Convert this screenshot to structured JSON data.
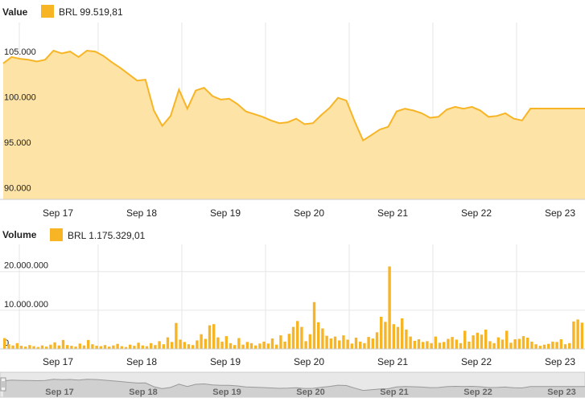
{
  "chart_data": [
    {
      "type": "area",
      "title": "Value",
      "legend": "BRL 99.519,81",
      "yticks": [
        "90.000",
        "95.000",
        "100.000",
        "105.000"
      ],
      "ylim": [
        89500,
        109000
      ],
      "xlabels": [
        "Sep 17",
        "Sep 18",
        "Sep 19",
        "Sep 20",
        "Sep 21",
        "Sep 22",
        "Sep 23"
      ],
      "x": [
        16.0,
        16.1,
        16.2,
        16.3,
        16.4,
        16.5,
        16.6,
        16.7,
        16.8,
        16.9,
        17.0,
        17.1,
        17.2,
        17.3,
        17.4,
        17.5,
        17.6,
        17.7,
        17.8,
        17.9,
        18.0,
        18.1,
        18.2,
        18.3,
        18.4,
        18.5,
        18.6,
        18.7,
        18.8,
        18.9,
        19.0,
        19.1,
        19.2,
        19.3,
        19.4,
        19.5,
        19.6,
        19.7,
        19.8,
        19.9,
        20.0,
        20.1,
        20.2,
        20.3,
        20.4,
        20.5,
        20.6,
        20.7,
        20.8,
        20.9,
        21.0,
        21.1,
        21.2,
        21.3,
        21.4,
        21.5,
        21.6,
        21.7,
        21.8,
        21.9,
        22.0,
        22.1,
        22.2,
        22.3,
        22.4,
        22.5,
        22.6,
        22.7,
        22.8,
        22.9,
        23.0,
        23.1,
        23.2,
        23.3,
        23.4
      ],
      "values": [
        104500,
        105200,
        105000,
        104900,
        104700,
        104900,
        105900,
        105600,
        105800,
        105200,
        105900,
        105800,
        105300,
        104600,
        104000,
        103300,
        102600,
        102700,
        99300,
        97600,
        98700,
        101600,
        99500,
        101500,
        101800,
        100900,
        100500,
        100600,
        100000,
        99200,
        98900,
        98600,
        98200,
        97900,
        98000,
        98400,
        97800,
        97900,
        98800,
        99600,
        100700,
        100400,
        98100,
        96000,
        96600,
        97200,
        97500,
        99200,
        99500,
        99300,
        99000,
        98500,
        98600,
        99400,
        99700,
        99500,
        99700,
        99300,
        98600,
        98700,
        99000,
        98400,
        98200,
        99519.81,
        99519.81,
        99519.81,
        99519.81,
        99519.81,
        99519.81,
        99519.81,
        99519.81,
        99519.81,
        99519.81,
        99519.81,
        99519.81
      ],
      "color": "#f7b526",
      "fill": "#fde3a5"
    },
    {
      "type": "bar",
      "title": "Volume",
      "legend": "BRL 1.175.329,01",
      "yticks": [
        "0",
        "10.000.000",
        "20.000.000"
      ],
      "ylim": [
        0,
        27000000
      ],
      "xlabels": [
        "Sep 17",
        "Sep 18",
        "Sep 19",
        "Sep 20",
        "Sep 21",
        "Sep 22",
        "Sep 23"
      ],
      "color": "#f7b526",
      "x": [
        16.0,
        16.05,
        16.1,
        16.15,
        16.2,
        16.25,
        16.3,
        16.35,
        16.4,
        16.45,
        16.5,
        16.55,
        16.6,
        16.65,
        16.7,
        16.75,
        16.8,
        16.85,
        16.9,
        16.95,
        17.0,
        17.05,
        17.1,
        17.15,
        17.2,
        17.25,
        17.3,
        17.35,
        17.4,
        17.45,
        17.5,
        17.55,
        17.6,
        17.65,
        17.7,
        17.75,
        17.8,
        17.85,
        17.9,
        17.95,
        18.0,
        18.05,
        18.1,
        18.15,
        18.2,
        18.25,
        18.3,
        18.35,
        18.4,
        18.45,
        18.5,
        18.55,
        18.6,
        18.65,
        18.7,
        18.75,
        18.8,
        18.85,
        18.9,
        18.95,
        19.0,
        19.05,
        19.1,
        19.15,
        19.2,
        19.25,
        19.3,
        19.35,
        19.4,
        19.45,
        19.5,
        19.55,
        19.6,
        19.65,
        19.7,
        19.75,
        19.8,
        19.85,
        19.9,
        19.95,
        20.0,
        20.05,
        20.1,
        20.15,
        20.2,
        20.25,
        20.3,
        20.35,
        20.4,
        20.45,
        20.5,
        20.55,
        20.6,
        20.65,
        20.7,
        20.75,
        20.8,
        20.85,
        20.9,
        20.95,
        21.0,
        21.05,
        21.1,
        21.15,
        21.2,
        21.25,
        21.3,
        21.35,
        21.4,
        21.45,
        21.5,
        21.55,
        21.6,
        21.65,
        21.7,
        21.75,
        21.8,
        21.85,
        21.9,
        21.95,
        22.0,
        22.05,
        22.1,
        22.15,
        22.2,
        22.25,
        22.3,
        22.35,
        22.4,
        22.45,
        22.5,
        22.55,
        22.6,
        22.65,
        22.7,
        22.75,
        22.8,
        22.85,
        22.9,
        22.95,
        23.0,
        23.05,
        23.1,
        23.15,
        23.2,
        23.25,
        23.3
      ],
      "values": [
        2800000,
        1200000,
        900000,
        1500000,
        800000,
        600000,
        1000000,
        700000,
        500000,
        900000,
        600000,
        1100000,
        1700000,
        900000,
        2300000,
        1000000,
        800000,
        600000,
        1400000,
        900000,
        2300000,
        1200000,
        800000,
        700000,
        1000000,
        600000,
        900000,
        1300000,
        700000,
        500000,
        1100000,
        800000,
        1600000,
        900000,
        700000,
        1500000,
        1000000,
        2000000,
        1200000,
        3000000,
        1800000,
        6700000,
        2400000,
        1800000,
        1200000,
        1000000,
        2200000,
        3800000,
        2600000,
        6100000,
        6400000,
        3000000,
        1900000,
        3300000,
        1500000,
        1000000,
        2800000,
        1100000,
        1800000,
        1500000,
        900000,
        1400000,
        1900000,
        1400000,
        2700000,
        1100000,
        3500000,
        1900000,
        3900000,
        5700000,
        7200000,
        5700000,
        2000000,
        3800000,
        12100000,
        6900000,
        5300000,
        3400000,
        2700000,
        3200000,
        2200000,
        3500000,
        2400000,
        1400000,
        2900000,
        1900000,
        1500000,
        3100000,
        2700000,
        4300000,
        8300000,
        7000000,
        21300000,
        6400000,
        5700000,
        7900000,
        5000000,
        3200000,
        2100000,
        2500000,
        1800000,
        2000000,
        1500000,
        3200000,
        1600000,
        1800000,
        2600000,
        3100000,
        2400000,
        1500000,
        4700000,
        1900000,
        3500000,
        4200000,
        3700000,
        5000000,
        2000000,
        1500000,
        3000000,
        2400000,
        4700000,
        1600000,
        2500000,
        2600000,
        3300000,
        2900000,
        1900000,
        1200000,
        800000,
        1100000,
        1300000,
        1900000,
        1800000,
        2500000,
        1200000,
        1500000,
        7100000,
        7600000,
        6800000,
        5400000,
        5100000,
        5700000,
        4200000
      ]
    }
  ],
  "navigator": {
    "xlabels": [
      "Sep 17",
      "Sep 18",
      "Sep 19",
      "Sep 20",
      "Sep 21",
      "Sep 22",
      "Sep 23"
    ]
  }
}
